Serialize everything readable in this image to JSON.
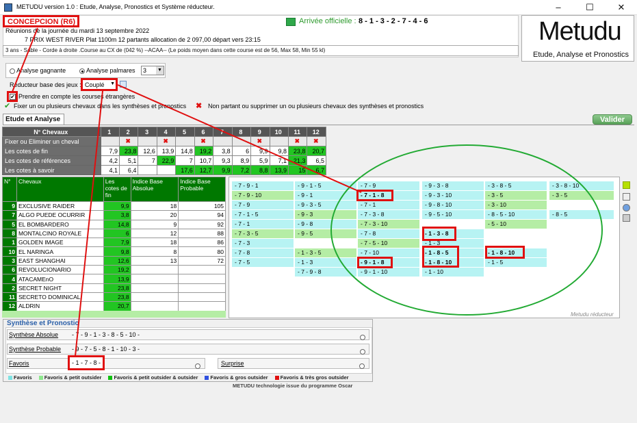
{
  "window": {
    "title": "METUDU version 1.0  : Etude, Analyse,  Pronostics et Système réducteur.",
    "min_btn": "–",
    "max_btn": "☐",
    "close_btn": "✕"
  },
  "header": {
    "hippodrome": "CONCEPCION (R6)",
    "reunion": "Réunions de la journée du mardi 13 septembre 2022",
    "course": "7 PRIX WEST RIVER Plat 1100m 12 partants allocation de 2 097,00 départ vers 23:15",
    "arrivee_label": "Arrivée officielle :",
    "arrivee_value": "8 - 1 - 3 - 2 - 7 - 4 - 6",
    "race_conditions": "3 ans - Sable - Corde à droite .Course au CX de (042 %)  --ACAA--  (Le poids moyen dans cette course est de 56, Max 58, Min 55 kl)"
  },
  "logo": {
    "title": "Metudu",
    "subtitle": "Etude, Analyse et Pronostics"
  },
  "options": {
    "analyse_gagnante": "Analyse gagnante",
    "analyse_palmares": "Analyse palmares",
    "palmares_value": "3",
    "reducteur_label": "Réducteur base des jeux :",
    "reducteur_value": "Couplé",
    "courses_etrangeres": "Prendre en compte les courses étrangères",
    "fixer_label": "Fixer un ou plusieurs chevaux dans les synthèses et pronostics",
    "nonpartant_label": "Non partant ou supprimer un ou plusieurs chevaux des synthèses et pronostics"
  },
  "tab_label": "Etude et Analyse",
  "valider_label": "Valider",
  "grid": {
    "header_label": "N° Chevaux",
    "numbers": [
      "1",
      "2",
      "3",
      "4",
      "5",
      "6",
      "7",
      "8",
      "9",
      "10",
      "11",
      "12"
    ],
    "rows": [
      {
        "label": "Fixer ou Eliminer un cheval",
        "cells": [
          "",
          "✖",
          "",
          "✖",
          "",
          "✖",
          "",
          "",
          "✖",
          "",
          "✖",
          "✖"
        ]
      },
      {
        "label": "Les cotes de fin",
        "cells": [
          "7,9",
          "23,8",
          "12,6",
          "13,9",
          "14,8",
          "19,2",
          "3,8",
          "6",
          "9,9",
          "9,8",
          "23,8",
          "20,7"
        ],
        "cls": [
          "",
          "g",
          "",
          "",
          "",
          "g",
          "",
          "",
          "",
          "",
          "g",
          "g"
        ]
      },
      {
        "label": "Les cotes de références",
        "cells": [
          "4,2",
          "5,1",
          "7",
          "22,9",
          "7",
          "10,7",
          "9,3",
          "8,9",
          "5,9",
          "7,1",
          "21,3",
          "6,5"
        ],
        "cls": [
          "",
          "",
          "",
          "g",
          "",
          "",
          "",
          "",
          "",
          "",
          "g",
          ""
        ]
      },
      {
        "label": "Les cotes à savoir",
        "cells": [
          "4,1",
          "6,4",
          "",
          "",
          "17,6",
          "12,7",
          "9,9",
          "7,2",
          "8,8",
          "13,9",
          "15",
          "6,7"
        ],
        "cls": [
          "",
          "",
          "",
          "",
          "g",
          "g",
          "g",
          "g",
          "g",
          "g",
          "g",
          "g"
        ]
      }
    ]
  },
  "horses": {
    "headers": [
      "N°",
      "Chevaux",
      "Les cotes de fin",
      "Indice Base Absolue",
      "Indice Base Probable"
    ],
    "rows": [
      {
        "n": "9",
        "name": "EXCLUSIVE RAIDER",
        "cote": "9,9",
        "abs": "18",
        "prob": "105"
      },
      {
        "n": "7",
        "name": "ALGO PUEDE OCURRIR",
        "cote": "3,8",
        "abs": "20",
        "prob": "94"
      },
      {
        "n": "5",
        "name": "EL BOMBARDERO",
        "cote": "14,8",
        "abs": "9",
        "prob": "92"
      },
      {
        "n": "8",
        "name": "MONTALCINO ROYALE",
        "cote": "6",
        "abs": "12",
        "prob": "88"
      },
      {
        "n": "1",
        "name": "GOLDEN IMAGE",
        "cote": "7,9",
        "abs": "18",
        "prob": "86"
      },
      {
        "n": "10",
        "name": "EL NARINGA",
        "cote": "9,8",
        "abs": "8",
        "prob": "80"
      },
      {
        "n": "3",
        "name": "EAST SHANGHAI",
        "cote": "12,6",
        "abs": "13",
        "prob": "72"
      },
      {
        "n": "6",
        "name": "REVOLUCIONARIO",
        "cote": "19,2",
        "abs": "",
        "prob": ""
      },
      {
        "n": "4",
        "name": "ATACAMEnO",
        "cote": "13,9",
        "abs": "",
        "prob": ""
      },
      {
        "n": "2",
        "name": "SECRET NIGHT",
        "cote": "23,8",
        "abs": "",
        "prob": ""
      },
      {
        "n": "11",
        "name": "SECRETO DOMINICAL",
        "cote": "23,8",
        "abs": "",
        "prob": ""
      },
      {
        "n": "12",
        "name": "ALDRIN",
        "cote": "20,7",
        "abs": "",
        "prob": ""
      }
    ]
  },
  "reducteur": {
    "footer": "Metudu réducteur",
    "columns": [
      [
        {
          "t": "- 7 - 9 - 1",
          "c": "cy"
        },
        {
          "t": "- 7 - 9 - 10",
          "c": "cg"
        },
        {
          "t": "- 7 - 9",
          "c": "cy"
        },
        {
          "t": "- 7 - 1 - 5",
          "c": "cy"
        },
        {
          "t": "- 7 - 1",
          "c": "cy"
        },
        {
          "t": "- 7 - 3 - 5",
          "c": "cg"
        },
        {
          "t": "- 7 - 3",
          "c": "cy"
        },
        {
          "t": "- 7 - 8",
          "c": "cy"
        },
        {
          "t": "- 7 - 5",
          "c": "cy"
        }
      ],
      [
        {
          "t": "- 9 - 1 - 5",
          "c": "cy"
        },
        {
          "t": "- 9 - 1",
          "c": "cy"
        },
        {
          "t": "- 9 - 3 - 5",
          "c": "cy"
        },
        {
          "t": "- 9 - 3",
          "c": "cg"
        },
        {
          "t": "- 9 - 8",
          "c": "cy"
        },
        {
          "t": "- 9 - 5",
          "c": "cg"
        },
        {
          "t": "",
          "c": "cw"
        },
        {
          "t": "- 1 - 3 - 5",
          "c": "cg"
        },
        {
          "t": "- 1 - 3",
          "c": "cy"
        },
        {
          "t": "- 7 - 9 - 8",
          "c": "cy"
        }
      ],
      [
        {
          "t": "- 7 - 9",
          "c": "cy"
        },
        {
          "t": "- 7 - 1 - 8",
          "c": "cy",
          "b": 1
        },
        {
          "t": "- 7 - 1",
          "c": "cy"
        },
        {
          "t": "- 7 - 3 - 8",
          "c": "cy"
        },
        {
          "t": "- 7 - 3 - 10",
          "c": "cg"
        },
        {
          "t": "- 7 - 8",
          "c": "cy"
        },
        {
          "t": "- 7 - 5 - 10",
          "c": "cg"
        },
        {
          "t": "- 7 - 10",
          "c": "cy"
        },
        {
          "t": "- 9 - 1 - 8",
          "c": "cy",
          "b": 1
        },
        {
          "t": "- 9 - 1 - 10",
          "c": "cy"
        }
      ],
      [
        {
          "t": "- 9 - 3 - 8",
          "c": "cy"
        },
        {
          "t": "- 9 - 3 - 10",
          "c": "cy"
        },
        {
          "t": "- 9 - 8 - 10",
          "c": "cy"
        },
        {
          "t": "- 9 - 5 - 10",
          "c": "cy"
        },
        {
          "t": "",
          "c": "cw"
        },
        {
          "t": "- 1 - 3 - 8",
          "c": "cy",
          "b": 1
        },
        {
          "t": "- 1 - 3",
          "c": "cy"
        },
        {
          "t": "- 1 - 8 - 5",
          "c": "cy",
          "b": 1
        },
        {
          "t": "- 1 - 8 - 10",
          "c": "cy",
          "b": 1
        },
        {
          "t": "- 1 - 10",
          "c": "cy"
        }
      ],
      [
        {
          "t": "- 3 - 8 - 5",
          "c": "cy"
        },
        {
          "t": "- 3 - 5",
          "c": "cg"
        },
        {
          "t": "- 3 - 10",
          "c": "cg"
        },
        {
          "t": "- 8 - 5 - 10",
          "c": "cy"
        },
        {
          "t": "- 5 - 10",
          "c": "cg"
        },
        {
          "t": "",
          "c": "cw"
        },
        {
          "t": "",
          "c": "cw"
        },
        {
          "t": "- 1 - 8 - 10",
          "c": "cy",
          "b": 1
        },
        {
          "t": "- 1 - 5",
          "c": "cy"
        }
      ],
      [
        {
          "t": "- 3 - 8 - 10",
          "c": "cy"
        },
        {
          "t": "- 3 - 5",
          "c": "cg"
        },
        {
          "t": "",
          "c": "cw"
        },
        {
          "t": "- 8 - 5",
          "c": "cy"
        }
      ]
    ]
  },
  "synthese": {
    "title": "Synthèse et Pronostic",
    "absolue_label": "Synthèse Absolue",
    "absolue_value": "- 7 - 9 - 1 - 3 - 8 - 5 - 10 -",
    "probable_label": "Synthèse Probable",
    "probable_value": "- 9 - 7 - 5 - 8 - 1 - 10 - 3 -",
    "favoris_label": "Favoris",
    "favoris_value": "- 1 - 7 - 8 -",
    "surprise_label": "Surprise"
  },
  "legend": {
    "items": [
      {
        "label": "Favoris",
        "color": "#7fe3e3"
      },
      {
        "label": "Favoris & petit outsider",
        "color": "#8ee88e"
      },
      {
        "label": "Favoris & petit outsider & outsider",
        "color": "#10c010"
      },
      {
        "label": "Favoris & gros outsider",
        "color": "#3050e0"
      },
      {
        "label": "Favoris & très gros outsider",
        "color": "#e01010"
      }
    ],
    "credit": "METUDU technologie issue du programme Oscar"
  },
  "colors": {
    "accent_red": "#e01010",
    "dark_green": "#007800",
    "green": "#22c522",
    "cyan": "#b7f3f3",
    "ellipse": "#22aa33"
  }
}
